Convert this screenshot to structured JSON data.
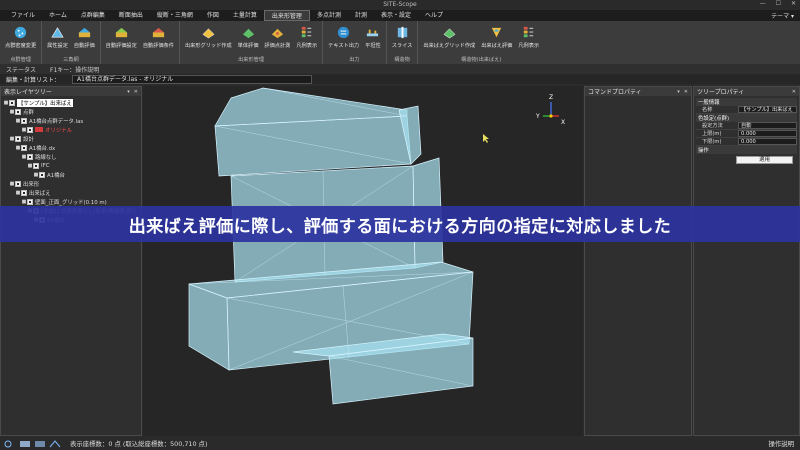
{
  "window": {
    "title": "SITE-Scope",
    "controls": [
      "—",
      "☐",
      "✕"
    ]
  },
  "menubar": {
    "items": [
      "ファイル",
      "ホーム",
      "点群編集",
      "断面抽出",
      "縦断・三角網",
      "作図",
      "土量計算",
      "出来形管理",
      "多点計測",
      "計測",
      "表示・設定",
      "ヘルプ"
    ],
    "active_index": 7,
    "theme": "テーマ ▾"
  },
  "ribbon": {
    "groups": [
      {
        "label": "点群管理",
        "buttons": [
          "点群密度変更"
        ]
      },
      {
        "label": "三角網",
        "buttons": [
          "属性設定",
          "自動評価"
        ]
      },
      {
        "label": "",
        "buttons": [
          "自動評価設定",
          "自動評価条件"
        ]
      },
      {
        "label": "出来形管理",
        "buttons": [
          "出来形グリッド作成",
          "単体評価",
          "評価点計測",
          "凡例表示"
        ]
      },
      {
        "label": "出力",
        "buttons": [
          "テキスト出力",
          "平坦性"
        ]
      },
      {
        "label": "構造物",
        "buttons": [
          "スライス"
        ]
      },
      {
        "label": "構造物(出来ばえ)",
        "buttons": [
          "出来ばえグリッド作成",
          "出来ばえ評価",
          "凡例表示"
        ]
      }
    ]
  },
  "status": {
    "label": "ステータス",
    "hint": "F1キー：操作説明"
  },
  "edit": {
    "label": "編集・計算リスト：",
    "value": "A1橋台点群データ.las - オリジナル"
  },
  "layer_panel": {
    "title": "表示レイヤツリー",
    "rows": [
      {
        "indent": 0,
        "label": "【サンプル】出来ばえ",
        "checked": true,
        "selected": true
      },
      {
        "indent": 1,
        "label": "点群",
        "checked": true
      },
      {
        "indent": 2,
        "label": "A1橋台点群データ.las",
        "checked": true
      },
      {
        "indent": 3,
        "label": "オリジナル",
        "checked": true,
        "red": true,
        "swatch": "#d23a3a"
      },
      {
        "indent": 1,
        "label": "設計",
        "checked": true
      },
      {
        "indent": 2,
        "label": "A1橋台.dx",
        "checked": true
      },
      {
        "indent": 3,
        "label": "路線なし",
        "checked": true
      },
      {
        "indent": 4,
        "label": "IFC",
        "checked": true
      },
      {
        "indent": 5,
        "label": "A1橋台",
        "checked": true
      },
      {
        "indent": 1,
        "label": "出来形",
        "checked": true
      },
      {
        "indent": 2,
        "label": "出来ばえ",
        "checked": true
      },
      {
        "indent": 3,
        "label": "壁面_正面_グリッド(0.10 m)",
        "checked": true
      },
      {
        "indent": 4,
        "label": "[手動1] 設置変更なし(結果/規模値(度))",
        "checked": true
      },
      {
        "indent": 5,
        "label": "A1橋台",
        "checked": true
      }
    ]
  },
  "command_panel": {
    "title": "コマンドプロパティ"
  },
  "tree_panel": {
    "title": "ツリープロパティ",
    "sections": [
      {
        "category": "一般情報",
        "rows": [
          {
            "k": "名称",
            "v": "【サンプル】出来ばえ"
          }
        ]
      },
      {
        "category": "色設定(点群)",
        "rows": [
          {
            "k": "設定方法",
            "v": "自動"
          },
          {
            "k": "上限(m)",
            "v": "0.000"
          },
          {
            "k": "下限(m)",
            "v": "0.000"
          }
        ]
      },
      {
        "category": "操作",
        "rows": []
      }
    ],
    "apply_label": "適用"
  },
  "axis": {
    "z": "Z",
    "y": "Y",
    "x": "X"
  },
  "caption": "出来ばえ評価に際し、評価する面における方向の指定に対応しました",
  "bottom": {
    "info": "表示座標数：0 点 (取込総座標数：500,710 点)",
    "right": "操作説明"
  },
  "colors": {
    "caption_bg": "#2d349e",
    "mesh_fill": "#a8e0f0",
    "mesh_edge": "#d8f4ff",
    "viewport_bg": "#262626"
  }
}
